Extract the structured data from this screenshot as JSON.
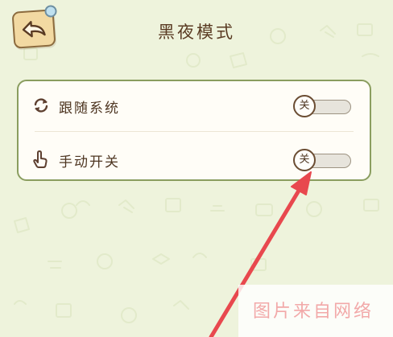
{
  "page_title": "黑夜模式",
  "back_button": {
    "icon": "back-arrow-icon"
  },
  "settings": {
    "rows": [
      {
        "label": "跟随系统",
        "icon": "refresh-icon",
        "toggle_label": "关",
        "state": "off"
      },
      {
        "label": "手动开关",
        "icon": "hand-pointer-icon",
        "toggle_label": "关",
        "state": "off"
      }
    ]
  },
  "watermark": {
    "text": "图片来自网络"
  },
  "colors": {
    "background": "#eef3dc",
    "card_border": "#8a9d5f",
    "text": "#4e3622",
    "annotation_arrow": "#e8484e"
  }
}
